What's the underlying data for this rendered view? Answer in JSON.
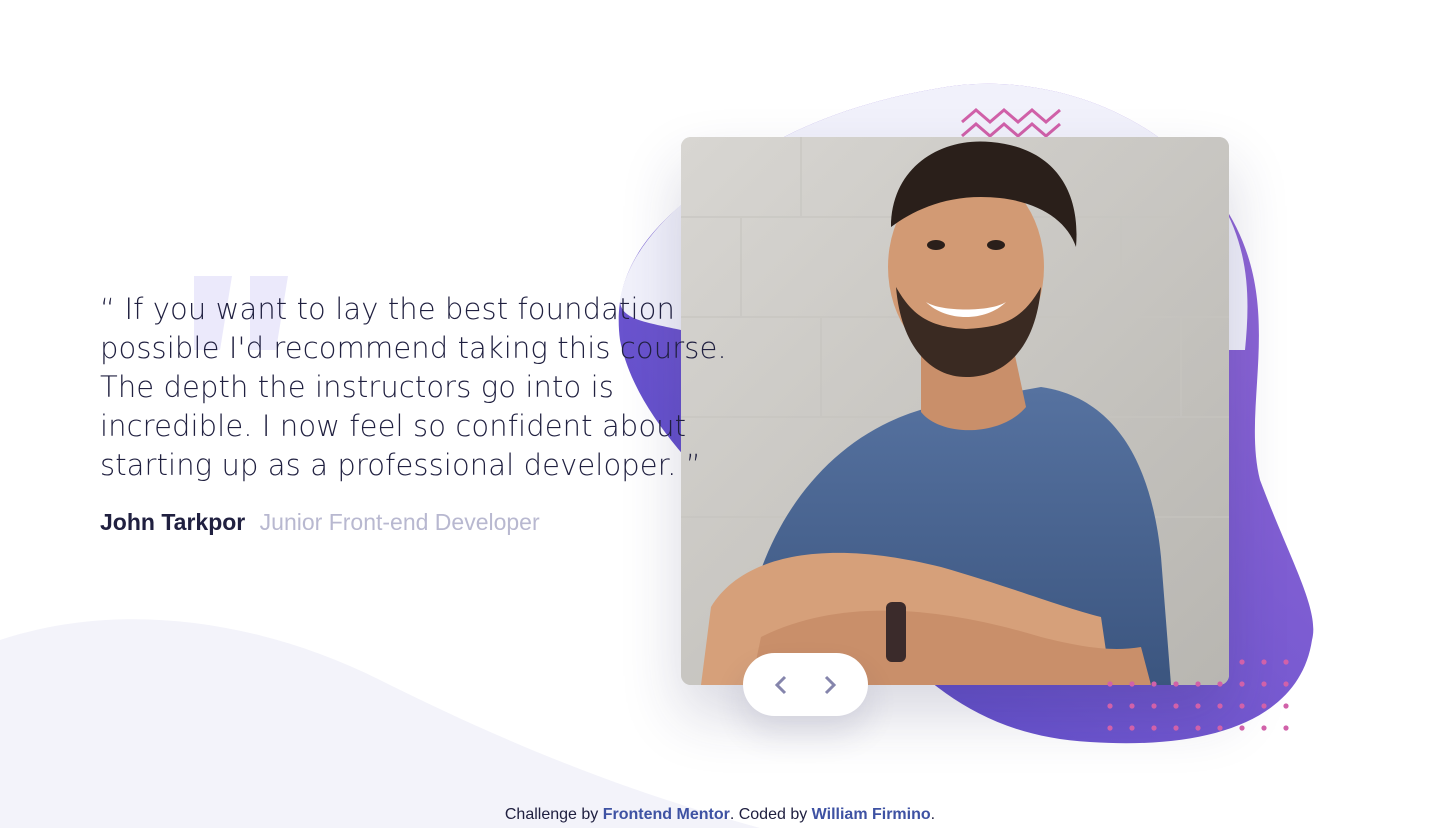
{
  "testimonial": {
    "quote": "“ If you want to lay the best foundation possible I'd recommend taking this course. The depth the instructors go into is incredible. I now feel so confident about starting up as a professional developer. ”",
    "author_name": "John Tarkpor",
    "author_role": "Junior Front-end Developer"
  },
  "navigation": {
    "prev_icon": "chevron-left-icon",
    "next_icon": "chevron-right-icon"
  },
  "footer": {
    "prefix": "Challenge by",
    "mentor_link": "Frontend Mentor",
    "middle": ". Coded by",
    "author_link": "William Firmino",
    "suffix": "."
  },
  "colors": {
    "dark_blue": "#202040",
    "grayish_blue": "#b8b8d0",
    "accent_purple": "#6b4ad6",
    "pattern_pink": "#d161a9"
  }
}
